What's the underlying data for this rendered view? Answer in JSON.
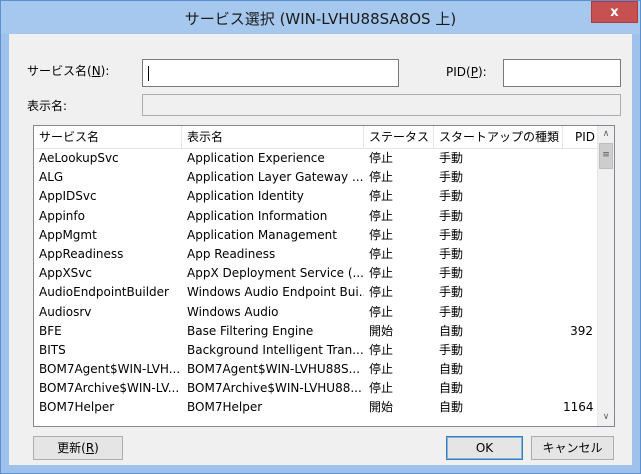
{
  "window": {
    "title": "サービス選択 (WIN-LVHU88SA8OS 上)",
    "close_label": "x"
  },
  "form": {
    "service_name_label_pre": "サービス名(",
    "service_name_label_key": "N",
    "service_name_label_post": "):",
    "service_name_value": "",
    "pid_label_pre": "PID(",
    "pid_label_key": "P",
    "pid_label_post": "):",
    "pid_value": "",
    "display_name_label": "表示名:",
    "display_name_value": ""
  },
  "list": {
    "columns": [
      "サービス名",
      "表示名",
      "ステータス",
      "スタートアップの種類",
      "PID"
    ],
    "rows": [
      [
        "AeLookupSvc",
        "Application Experience",
        "停止",
        "手動",
        ""
      ],
      [
        "ALG",
        "Application Layer Gateway ...",
        "停止",
        "手動",
        ""
      ],
      [
        "AppIDSvc",
        "Application Identity",
        "停止",
        "手動",
        ""
      ],
      [
        "Appinfo",
        "Application Information",
        "停止",
        "手動",
        ""
      ],
      [
        "AppMgmt",
        "Application Management",
        "停止",
        "手動",
        ""
      ],
      [
        "AppReadiness",
        "App Readiness",
        "停止",
        "手動",
        ""
      ],
      [
        "AppXSvc",
        "AppX Deployment Service (...",
        "停止",
        "手動",
        ""
      ],
      [
        "AudioEndpointBuilder",
        "Windows Audio Endpoint Bui...",
        "停止",
        "手動",
        ""
      ],
      [
        "Audiosrv",
        "Windows Audio",
        "停止",
        "手動",
        ""
      ],
      [
        "BFE",
        "Base Filtering Engine",
        "開始",
        "自動",
        "392"
      ],
      [
        "BITS",
        "Background Intelligent Tran...",
        "停止",
        "手動",
        ""
      ],
      [
        "BOM7Agent$WIN-LVH...",
        "BOM7Agent$WIN-LVHU88S...",
        "停止",
        "自動",
        ""
      ],
      [
        "BOM7Archive$WIN-LV...",
        "BOM7Archive$WIN-LVHU88...",
        "停止",
        "自動",
        ""
      ],
      [
        "BOM7Helper",
        "BOM7Helper",
        "開始",
        "自動",
        "1164"
      ]
    ]
  },
  "buttons": {
    "refresh_pre": "更新(",
    "refresh_key": "R",
    "refresh_post": ")",
    "ok": "OK",
    "cancel": "キャンセル"
  },
  "scrollbar": {
    "up_glyph": "∧",
    "down_glyph": "∨",
    "grip_glyph": "≡"
  }
}
